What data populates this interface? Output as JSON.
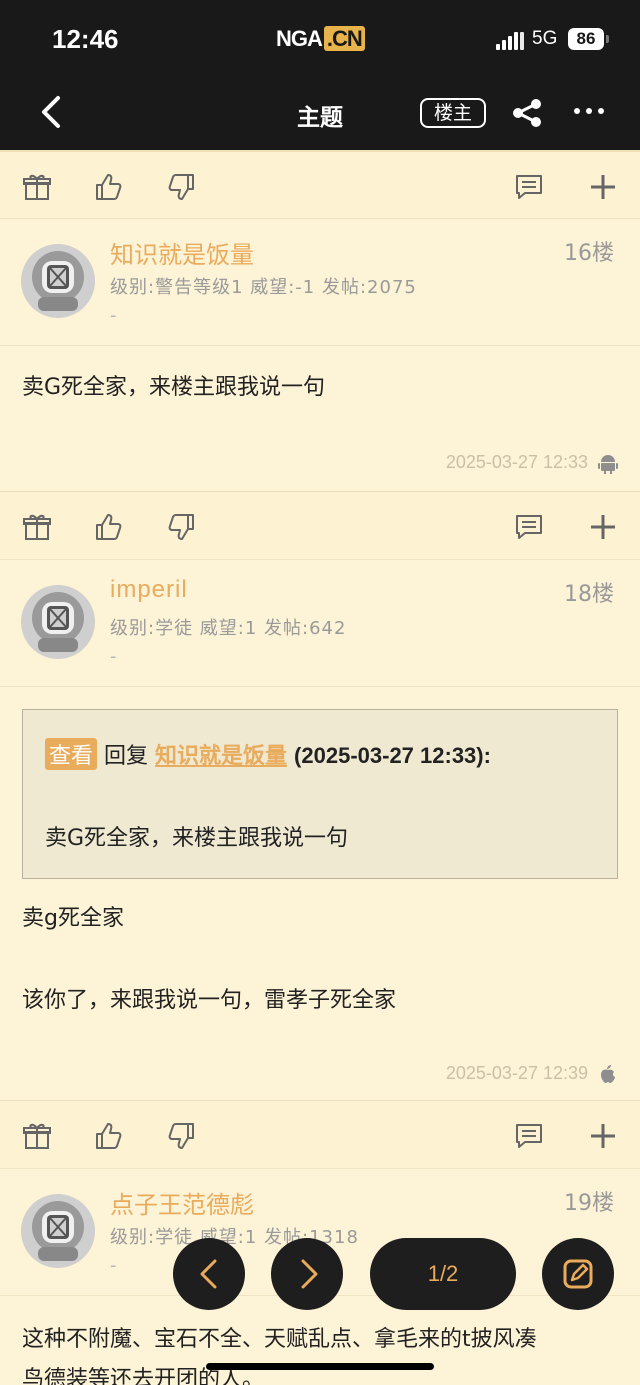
{
  "status_bar": {
    "time": "12:46",
    "logo": "NGA",
    "logo_suffix": ".CN",
    "network": "5G",
    "battery": "86"
  },
  "nav": {
    "title": "主题",
    "op_label": "楼主"
  },
  "posts": [
    {
      "username": "知识就是饭量",
      "floor": "16楼",
      "info": "级别:警告等级1  威望:-1  发帖:2075",
      "dash": "-",
      "text": "卖G死全家，来楼主跟我说一句",
      "time": "2025-03-27 12:33",
      "device_icon": "android-icon"
    },
    {
      "username": "imperil",
      "floor": "18楼",
      "info": "级别:学徒  威望:1  发帖:642",
      "dash": "-",
      "quote": {
        "tag": "查看",
        "reply": "回复",
        "user": "知识就是饭量",
        "date": "(2025-03-27 12:33):",
        "text": "卖G死全家，来楼主跟我说一句"
      },
      "text_line1": "卖g死全家",
      "text_line2": "该你了，来跟我说一句，雷孝子死全家",
      "time": "2025-03-27 12:39",
      "device_icon": "apple-icon"
    },
    {
      "username": "点子王范德彪",
      "floor": "19楼",
      "info": "级别:学徒  威望:1  发帖:1318",
      "dash": "-",
      "text_line1": "这种不附魔、宝石不全、天赋乱点、拿毛来的t披风凑",
      "text_line2": "鸟德装等还去开团的人。"
    }
  ],
  "pager": {
    "label": "1/2"
  },
  "colors": {
    "accent": "#e9ab5c",
    "bg": "#fdf3d6",
    "topbar": "#191919"
  }
}
